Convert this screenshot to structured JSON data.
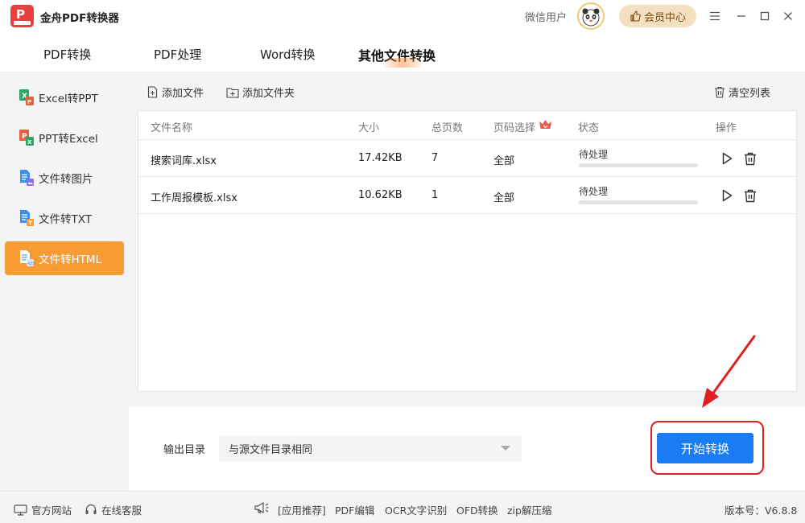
{
  "app": {
    "title": "金舟PDF转换器"
  },
  "header": {
    "user_name": "微信用户",
    "vip_label": "会员中心"
  },
  "tabs": [
    {
      "label": "PDF转换"
    },
    {
      "label": "PDF处理"
    },
    {
      "label": "Word转换"
    },
    {
      "label": "其他文件转换"
    }
  ],
  "sidebar": {
    "items": [
      {
        "label": "Excel转PPT",
        "icon": "excel-to-ppt-icon"
      },
      {
        "label": "PPT转Excel",
        "icon": "ppt-to-excel-icon"
      },
      {
        "label": "文件转图片",
        "icon": "file-to-image-icon"
      },
      {
        "label": "文件转TXT",
        "icon": "file-to-txt-icon"
      },
      {
        "label": "文件转HTML",
        "icon": "file-to-html-icon"
      }
    ]
  },
  "toolbar": {
    "add_file": "添加文件",
    "add_folder": "添加文件夹",
    "clear_list": "清空列表"
  },
  "table": {
    "columns": [
      "文件名称",
      "大小",
      "总页数",
      "页码选择",
      "状态",
      "操作"
    ],
    "rows": [
      {
        "name": "搜索词库.xlsx",
        "size": "17.42KB",
        "pages": "7",
        "page_select": "全部",
        "status": "待处理",
        "progress": 0
      },
      {
        "name": "工作周报模板.xlsx",
        "size": "10.62KB",
        "pages": "1",
        "page_select": "全部",
        "status": "待处理",
        "progress": 0
      }
    ]
  },
  "output": {
    "label": "输出目录",
    "selected": "与源文件目录相同"
  },
  "start_button": "开始转换",
  "statusbar": {
    "official_site": "官方网站",
    "online_service": "在线客服",
    "recommend": "[应用推荐]",
    "links": [
      "PDF编辑",
      "OCR文字识别",
      "OFD转换",
      "zip解压缩"
    ],
    "version": "版本号：V6.8.8"
  },
  "colors": {
    "accent_orange": "#f79c35",
    "primary_blue": "#1a7cf2",
    "highlight_red": "#e02020",
    "logo_red": "#e8413d"
  }
}
